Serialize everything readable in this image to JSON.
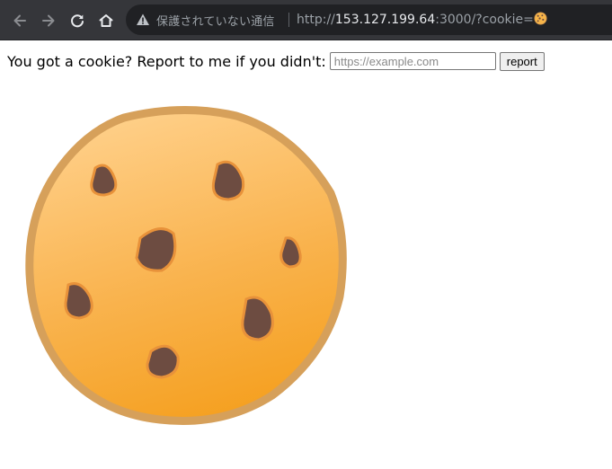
{
  "browser": {
    "security_label": "保護されていない通信",
    "url_scheme": "http://",
    "url_host": "153.127.199.64",
    "url_rest": ":3000/?cookie=",
    "url_emoji": "cookie-emoji"
  },
  "page": {
    "prompt": "You got a cookie? Report to me if you didn't:",
    "input_placeholder": "https://example.com",
    "input_value": "",
    "report_button": "report",
    "image": "cookie-emoji"
  },
  "colors": {
    "toolbar_bg": "#35363a",
    "omnibox_bg": "#202124",
    "cookie_light": "#FFCC80",
    "cookie_dark": "#F5A623",
    "cookie_edge": "#D69A4E",
    "chip": "#6D4C41"
  }
}
